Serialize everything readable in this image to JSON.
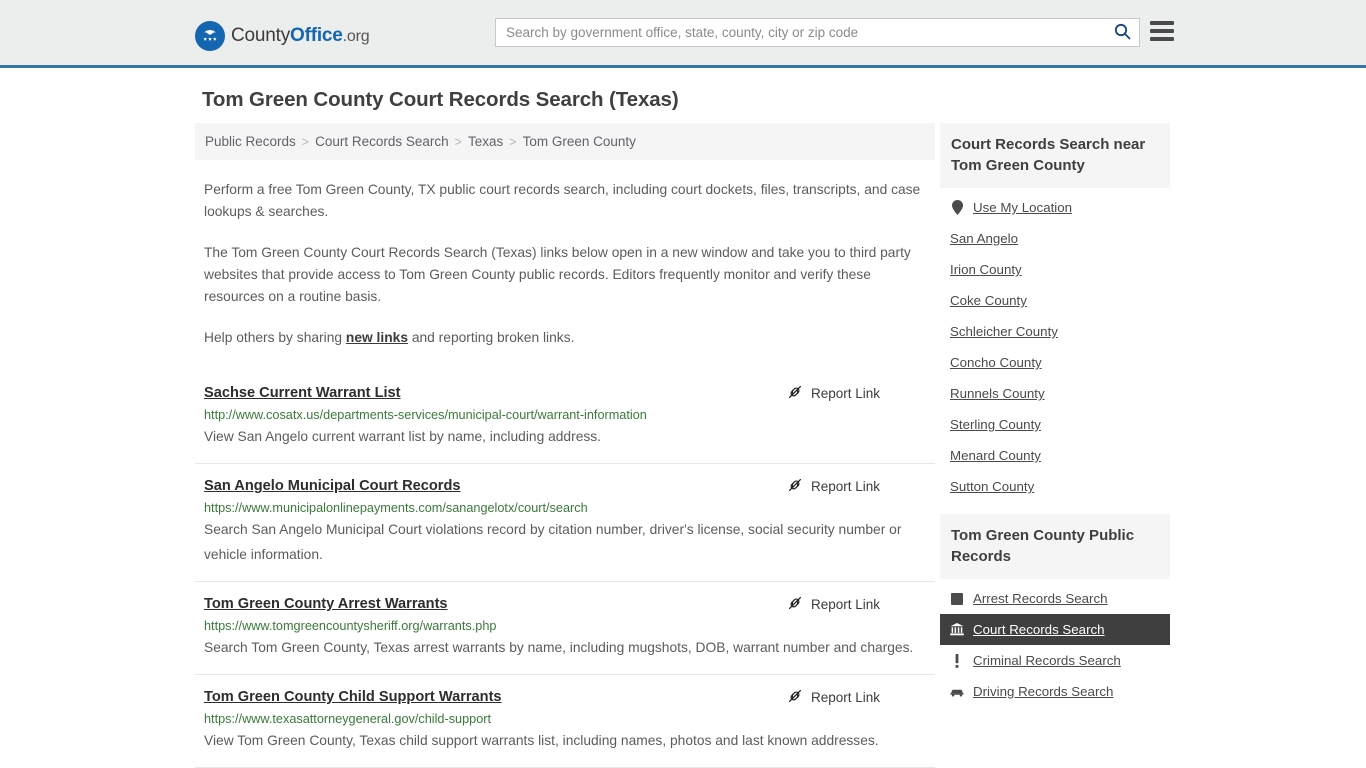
{
  "header": {
    "brand": {
      "part1": "County",
      "part2": "Office",
      "part3": ".org",
      "emblem_icon": "eagle-emblem-icon"
    },
    "search": {
      "placeholder": "Search by government office, state, county, city or zip code",
      "value": "",
      "search_icon": "search-icon"
    },
    "menu_icon": "hamburger-menu-icon",
    "accent_color": "#3a75a8"
  },
  "page": {
    "title": "Tom Green County Court Records Search (Texas)"
  },
  "breadcrumb": {
    "separator": ">",
    "items": [
      {
        "label": "Public Records"
      },
      {
        "label": "Court Records Search"
      },
      {
        "label": "Texas"
      },
      {
        "label": "Tom Green County"
      }
    ]
  },
  "intro": {
    "p1": "Perform a free Tom Green County, TX public court records search, including court dockets, files, transcripts, and case lookups & searches.",
    "p2": "The Tom Green County Court Records Search (Texas) links below open in a new window and take you to third party websites that provide access to Tom Green County public records. Editors frequently monitor and verify these resources on a routine basis.",
    "p3_before": "Help others by sharing ",
    "p3_link": "new links",
    "p3_after": " and reporting broken links."
  },
  "results": {
    "report_label": "Report Link",
    "report_icon": "broken-link-icon",
    "items": [
      {
        "title": "Sachse Current Warrant List",
        "url": "http://www.cosatx.us/departments-services/municipal-court/warrant-information",
        "description": "View San Angelo current warrant list by name, including address."
      },
      {
        "title": "San Angelo Municipal Court Records",
        "url": "https://www.municipalonlinepayments.com/sanangelotx/court/search",
        "description": "Search San Angelo Municipal Court violations record by citation number, driver's license, social security number or vehicle information."
      },
      {
        "title": "Tom Green County Arrest Warrants",
        "url": "https://www.tomgreencountysheriff.org/warrants.php",
        "description": "Search Tom Green County, Texas arrest warrants by name, including mugshots, DOB, warrant number and charges."
      },
      {
        "title": "Tom Green County Child Support Warrants",
        "url": "https://www.texasattorneygeneral.gov/child-support",
        "description": "View Tom Green County, Texas child support warrants list, including names, photos and last known addresses."
      }
    ]
  },
  "sidebar": {
    "nearby": {
      "heading": "Court Records Search near Tom Green County",
      "items": [
        {
          "label": "Use My Location",
          "icon": "map-pin-icon"
        },
        {
          "label": "San Angelo",
          "icon": ""
        },
        {
          "label": "Irion County",
          "icon": ""
        },
        {
          "label": "Coke County",
          "icon": ""
        },
        {
          "label": "Schleicher County",
          "icon": ""
        },
        {
          "label": "Concho County",
          "icon": ""
        },
        {
          "label": "Runnels County",
          "icon": ""
        },
        {
          "label": "Sterling County",
          "icon": ""
        },
        {
          "label": "Menard County",
          "icon": ""
        },
        {
          "label": "Sutton County",
          "icon": ""
        }
      ]
    },
    "public_records": {
      "heading": "Tom Green County Public Records",
      "items": [
        {
          "label": "Arrest Records Search",
          "icon": "square-badge-icon",
          "active": false
        },
        {
          "label": "Court Records Search",
          "icon": "courthouse-icon",
          "active": true
        },
        {
          "label": "Criminal Records Search",
          "icon": "exclamation-icon",
          "active": false
        },
        {
          "label": "Driving Records Search",
          "icon": "car-icon",
          "active": false
        }
      ]
    }
  }
}
